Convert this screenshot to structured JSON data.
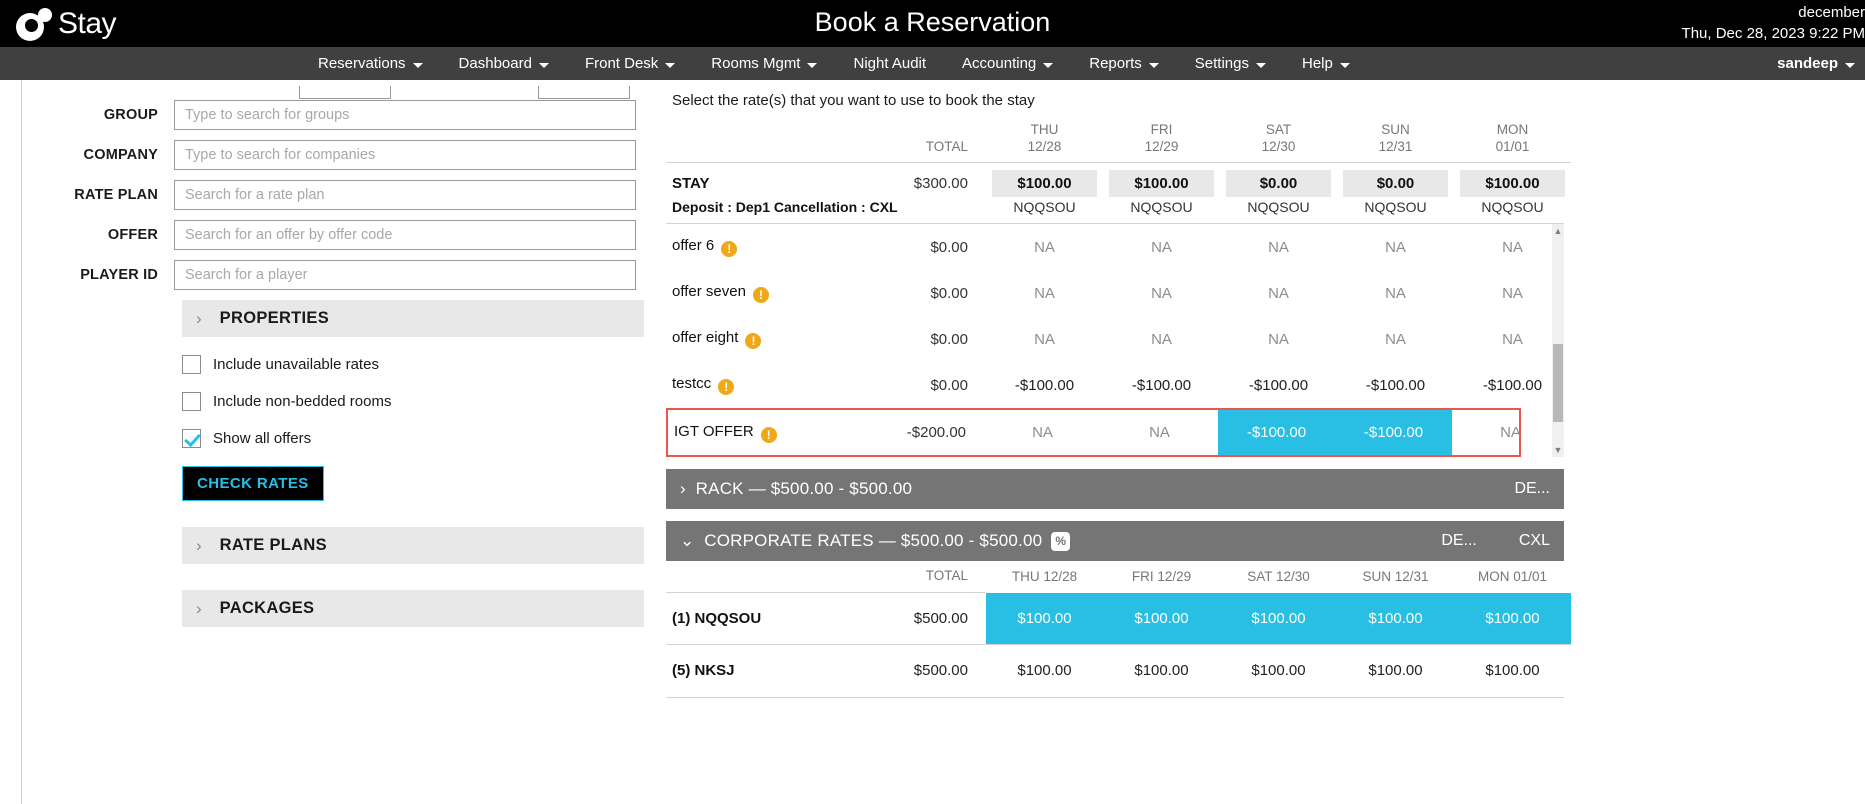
{
  "topbar": {
    "logo_text": "Stay",
    "title": "Book a Reservation",
    "environment": "december",
    "datetime": "Thu, Dec 28, 2023 9:22 PM"
  },
  "nav": {
    "items": [
      {
        "label": "Reservations",
        "has_caret": true
      },
      {
        "label": "Dashboard",
        "has_caret": true
      },
      {
        "label": "Front Desk",
        "has_caret": true
      },
      {
        "label": "Rooms Mgmt",
        "has_caret": true
      },
      {
        "label": "Night Audit",
        "has_caret": false
      },
      {
        "label": "Accounting",
        "has_caret": true
      },
      {
        "label": "Reports",
        "has_caret": true
      },
      {
        "label": "Settings",
        "has_caret": true
      },
      {
        "label": "Help",
        "has_caret": true
      }
    ],
    "user": "sandeep"
  },
  "form": {
    "fields": [
      {
        "label": "GROUP",
        "placeholder": "Type to search for groups",
        "value": ""
      },
      {
        "label": "COMPANY",
        "placeholder": "Type to search for companies",
        "value": ""
      },
      {
        "label": "RATE PLAN",
        "placeholder": "Search for a rate plan",
        "value": ""
      },
      {
        "label": "OFFER",
        "placeholder": "Search for an offer by offer code",
        "value": ""
      },
      {
        "label": "PLAYER ID",
        "placeholder": "Search for a player",
        "value": ""
      }
    ],
    "sections": [
      {
        "label": "PROPERTIES"
      },
      {
        "label": "RATE PLANS"
      },
      {
        "label": "PACKAGES"
      }
    ],
    "checkboxes": [
      {
        "label": "Include unavailable rates",
        "checked": false
      },
      {
        "label": "Include non-bedded rooms",
        "checked": false
      },
      {
        "label": "Show all offers",
        "checked": true
      }
    ],
    "check_rates_label": "CHECK RATES"
  },
  "rates": {
    "hint": "Select the rate(s) that you want to use to book the stay",
    "total_header": "TOTAL",
    "days": [
      {
        "dow": "THU",
        "date": "12/28"
      },
      {
        "dow": "FRI",
        "date": "12/29"
      },
      {
        "dow": "SAT",
        "date": "12/30"
      },
      {
        "dow": "SUN",
        "date": "12/31"
      },
      {
        "dow": "MON",
        "date": "01/01"
      }
    ],
    "stay": {
      "name": "STAY",
      "total": "$300.00",
      "values": [
        "$100.00",
        "$100.00",
        "$0.00",
        "$0.00",
        "$100.00"
      ],
      "sub_label": "Deposit : Dep1  Cancellation : CXL",
      "codes": [
        "NQQSOU",
        "NQQSOU",
        "NQQSOU",
        "NQQSOU",
        "NQQSOU"
      ]
    },
    "offers": [
      {
        "name": "offer 6",
        "total": "$0.00",
        "values": [
          "NA",
          "NA",
          "NA",
          "NA",
          "NA"
        ],
        "warn": true
      },
      {
        "name": "offer seven",
        "total": "$0.00",
        "values": [
          "NA",
          "NA",
          "NA",
          "NA",
          "NA"
        ],
        "warn": true
      },
      {
        "name": "offer eight",
        "total": "$0.00",
        "values": [
          "NA",
          "NA",
          "NA",
          "NA",
          "NA"
        ],
        "warn": true
      },
      {
        "name": "testcc",
        "total": "$0.00",
        "values": [
          "-$100.00",
          "-$100.00",
          "-$100.00",
          "-$100.00",
          "-$100.00"
        ],
        "warn": true
      }
    ],
    "selected_offer": {
      "name": "IGT OFFER",
      "total": "-$200.00",
      "warn": true,
      "cells": [
        {
          "text": "NA",
          "selected": false
        },
        {
          "text": "NA",
          "selected": false
        },
        {
          "text": "-$100.00",
          "selected": true
        },
        {
          "text": "-$100.00",
          "selected": true
        },
        {
          "text": "NA",
          "selected": false
        }
      ]
    }
  },
  "plans": {
    "rack": {
      "title": "RACK — $500.00 - $500.00",
      "chevron": "›",
      "right_labels": [
        "DE..."
      ],
      "pct_badge": ""
    },
    "corporate": {
      "title": "CORPORATE RATES — $500.00 - $500.00",
      "chevron": "⌄",
      "pct_badge": "%",
      "right_labels": [
        "DE...",
        "CXL"
      ],
      "total_header": "TOTAL",
      "days": [
        {
          "dow": "THU",
          "date": "12/28"
        },
        {
          "dow": "FRI",
          "date": "12/29"
        },
        {
          "dow": "SAT",
          "date": "12/30"
        },
        {
          "dow": "SUN",
          "date": "12/31"
        },
        {
          "dow": "MON",
          "date": "01/01"
        }
      ],
      "rows": [
        {
          "name": "(1) NQQSOU",
          "total": "$500.00",
          "values": [
            "$100.00",
            "$100.00",
            "$100.00",
            "$100.00",
            "$100.00"
          ],
          "selected": true
        },
        {
          "name": "(5) NKSJ",
          "total": "$500.00",
          "values": [
            "$100.00",
            "$100.00",
            "$100.00",
            "$100.00",
            "$100.00"
          ],
          "selected": false
        }
      ]
    }
  },
  "colors": {
    "accent_cyan": "#29bee4",
    "warn_orange": "#f0a818",
    "highlight_red": "#e8564c",
    "gray_bar": "#757575"
  }
}
